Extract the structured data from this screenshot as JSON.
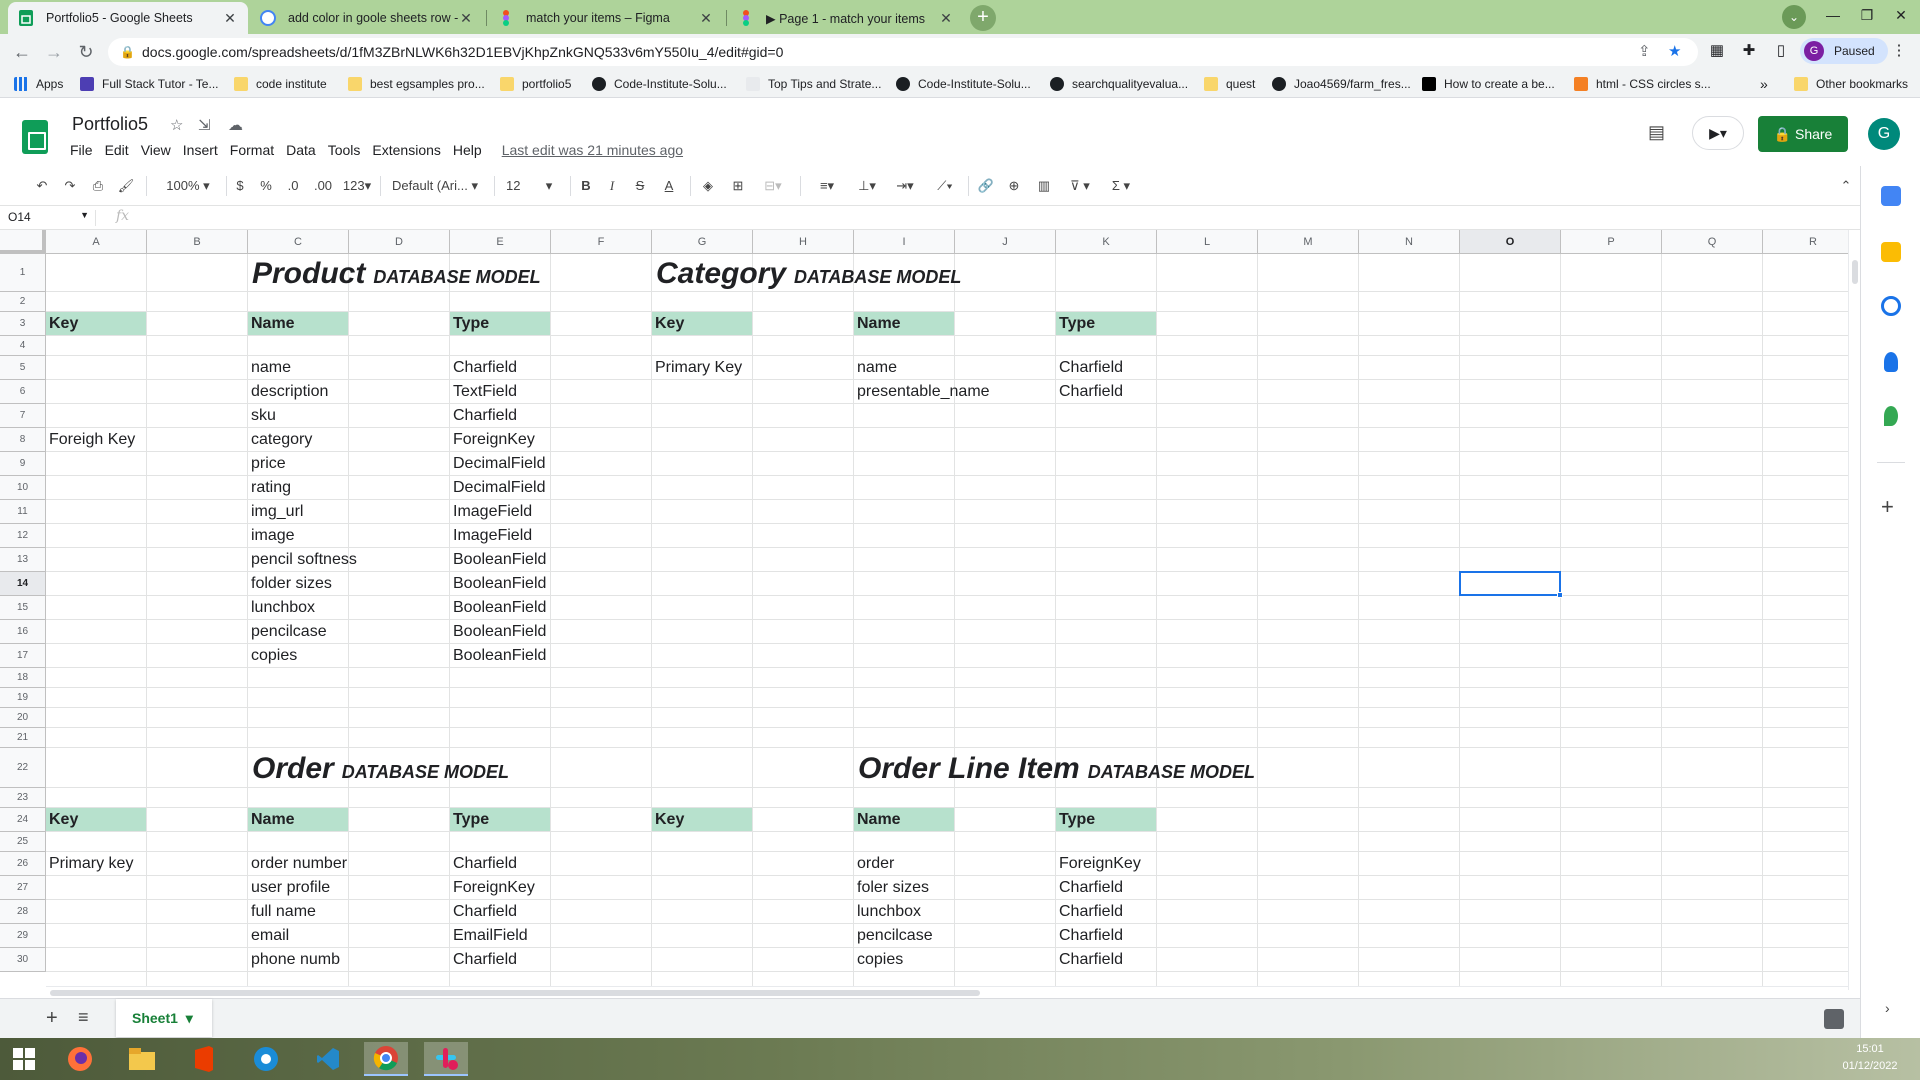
{
  "browser": {
    "tabs": [
      {
        "title": "Portfolio5 - Google Sheets",
        "active": true
      },
      {
        "title": "add color in goole sheets row - G",
        "active": false
      },
      {
        "title": "match your items – Figma",
        "active": false
      },
      {
        "title": "▶ Page 1 - match your items",
        "active": false
      }
    ],
    "url": "docs.google.com/spreadsheets/d/1fM3ZBrNLWK6h32D1EBVjKhpZnkGNQ533v6mY550Iu_4/edit#gid=0",
    "profile_label": "Paused",
    "profile_initial": "G",
    "bookmarks": [
      {
        "label": "Apps",
        "icon": "apps-grid-icon"
      },
      {
        "label": "Full Stack Tutor - Te...",
        "icon": "purple-book-icon"
      },
      {
        "label": "code institute",
        "icon": "folder-icon"
      },
      {
        "label": "best egsamples pro...",
        "icon": "folder-icon"
      },
      {
        "label": "portfolio5",
        "icon": "folder-icon"
      },
      {
        "label": "Code-Institute-Solu...",
        "icon": "github-icon"
      },
      {
        "label": "Top Tips and Strate...",
        "icon": "site-icon"
      },
      {
        "label": "Code-Institute-Solu...",
        "icon": "github-icon"
      },
      {
        "label": "searchqualityevalua...",
        "icon": "globe-icon"
      },
      {
        "label": "quest",
        "icon": "folder-icon"
      },
      {
        "label": "Joao4569/farm_fres...",
        "icon": "github-icon"
      },
      {
        "label": "How to create a be...",
        "icon": "video-icon"
      },
      {
        "label": "html - CSS circles s...",
        "icon": "stackoverflow-icon"
      }
    ],
    "other_bookmarks": "Other bookmarks",
    "more_bookmarks": "»"
  },
  "sheets": {
    "doc_title": "Portfolio5",
    "menus": [
      "File",
      "Edit",
      "View",
      "Insert",
      "Format",
      "Data",
      "Tools",
      "Extensions",
      "Help"
    ],
    "last_edit": "Last edit was 21 minutes ago",
    "share_label": "Share",
    "account_initial": "G",
    "toolbar": {
      "zoom": "100%",
      "currency": "$",
      "percent": "%",
      "dec_decrease": ".0",
      "dec_increase": ".00",
      "number_format": "123",
      "font": "Default (Ari...",
      "font_size": "12",
      "bold": "B",
      "italic": "I",
      "strike": "S",
      "text_color": "A"
    },
    "name_box": "O14",
    "fx": "fx",
    "columns": [
      "A",
      "B",
      "C",
      "D",
      "E",
      "F",
      "G",
      "H",
      "I",
      "J",
      "K",
      "L",
      "M",
      "N",
      "O",
      "P",
      "Q",
      "R"
    ],
    "selected_column": "O",
    "selected_row": "14",
    "rows": [
      "1",
      "2",
      "3",
      "4",
      "5",
      "6",
      "7",
      "8",
      "9",
      "10",
      "11",
      "12",
      "13",
      "14",
      "15",
      "16",
      "17",
      "18",
      "19",
      "20",
      "21",
      "22",
      "23",
      "24",
      "25",
      "26",
      "27",
      "28",
      "29",
      "30"
    ],
    "sheet_tab": "Sheet1",
    "sheet_tab_arrow": "▾",
    "add_sheet": "+",
    "all_sheets": "≡"
  },
  "models": {
    "product": {
      "title": "Product",
      "subtitle": "DATABASE MODEL",
      "headers": {
        "key": "Key",
        "name": "Name",
        "type": "Type"
      },
      "rows": [
        {
          "key": "",
          "name": "name",
          "type": "Charfield"
        },
        {
          "key": "",
          "name": "description",
          "type": "TextField"
        },
        {
          "key": "",
          "name": "sku",
          "type": "Charfield"
        },
        {
          "key": "Foreigh Key",
          "name": "category",
          "type": "ForeignKey"
        },
        {
          "key": "",
          "name": "price",
          "type": "DecimalField"
        },
        {
          "key": "",
          "name": "rating",
          "type": "DecimalField"
        },
        {
          "key": "",
          "name": "img_url",
          "type": "ImageField"
        },
        {
          "key": "",
          "name": "image",
          "type": "ImageField"
        },
        {
          "key": "",
          "name": "pencil softness",
          "type": "BooleanField"
        },
        {
          "key": "",
          "name": "folder sizes",
          "type": "BooleanField"
        },
        {
          "key": "",
          "name": "lunchbox",
          "type": "BooleanField"
        },
        {
          "key": "",
          "name": "pencilcase",
          "type": "BooleanField"
        },
        {
          "key": "",
          "name": "copies",
          "type": "BooleanField"
        }
      ]
    },
    "category": {
      "title": "Category",
      "subtitle": "DATABASE MODEL",
      "headers": {
        "key": "Key",
        "name": "Name",
        "type": "Type"
      },
      "rows": [
        {
          "key": "Primary Key",
          "name": "name",
          "type": "Charfield"
        },
        {
          "key": "",
          "name": "presentable_name",
          "type": "Charfield"
        }
      ]
    },
    "order": {
      "title": "Order",
      "subtitle": "DATABASE MODEL",
      "headers": {
        "key": "Key",
        "name": "Name",
        "type": "Type"
      },
      "rows": [
        {
          "key": "Primary key",
          "name": "order number",
          "type": "Charfield"
        },
        {
          "key": "",
          "name": "user profile",
          "type": "ForeignKey"
        },
        {
          "key": "",
          "name": "full name",
          "type": "Charfield"
        },
        {
          "key": "",
          "name": "email",
          "type": "EmailField"
        },
        {
          "key": "",
          "name": "phone numb",
          "type": "Charfield"
        }
      ]
    },
    "order_line_item": {
      "title": "Order Line Item",
      "subtitle": "DATABASE MODEL",
      "headers": {
        "key": "Key",
        "name": "Name",
        "type": "Type"
      },
      "rows": [
        {
          "key": "",
          "name": "order",
          "type": "ForeignKey"
        },
        {
          "key": "",
          "name": "foler sizes",
          "type": "Charfield"
        },
        {
          "key": "",
          "name": "lunchbox",
          "type": "Charfield"
        },
        {
          "key": "",
          "name": "pencilcase",
          "type": "Charfield"
        },
        {
          "key": "",
          "name": "copies",
          "type": "Charfield"
        }
      ]
    }
  },
  "colors": {
    "header_fill": "#b7e1cd",
    "share_green": "#188038",
    "selection_blue": "#1a73e8",
    "tabstrip_green": "#aed39a"
  },
  "taskbar": {
    "time": "15:01",
    "date": "01/12/2022",
    "apps": [
      "windows-start-icon",
      "firefox-icon",
      "file-explorer-icon",
      "office-icon",
      "edge-icon",
      "vscode-icon",
      "chrome-icon",
      "slack-icon"
    ]
  }
}
